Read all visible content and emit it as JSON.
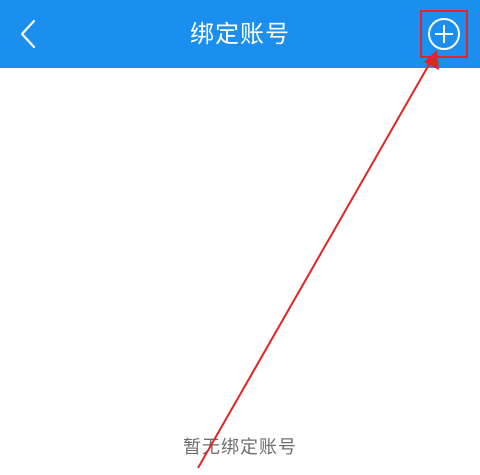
{
  "header": {
    "title": "绑定账号",
    "back_icon": "chevron-left-icon",
    "add_icon": "plus-circle-icon",
    "background_color": "#1b8ff0"
  },
  "main": {
    "empty_message": "暂无绑定账号"
  },
  "annotation": {
    "highlight_color": "#e0242a"
  }
}
